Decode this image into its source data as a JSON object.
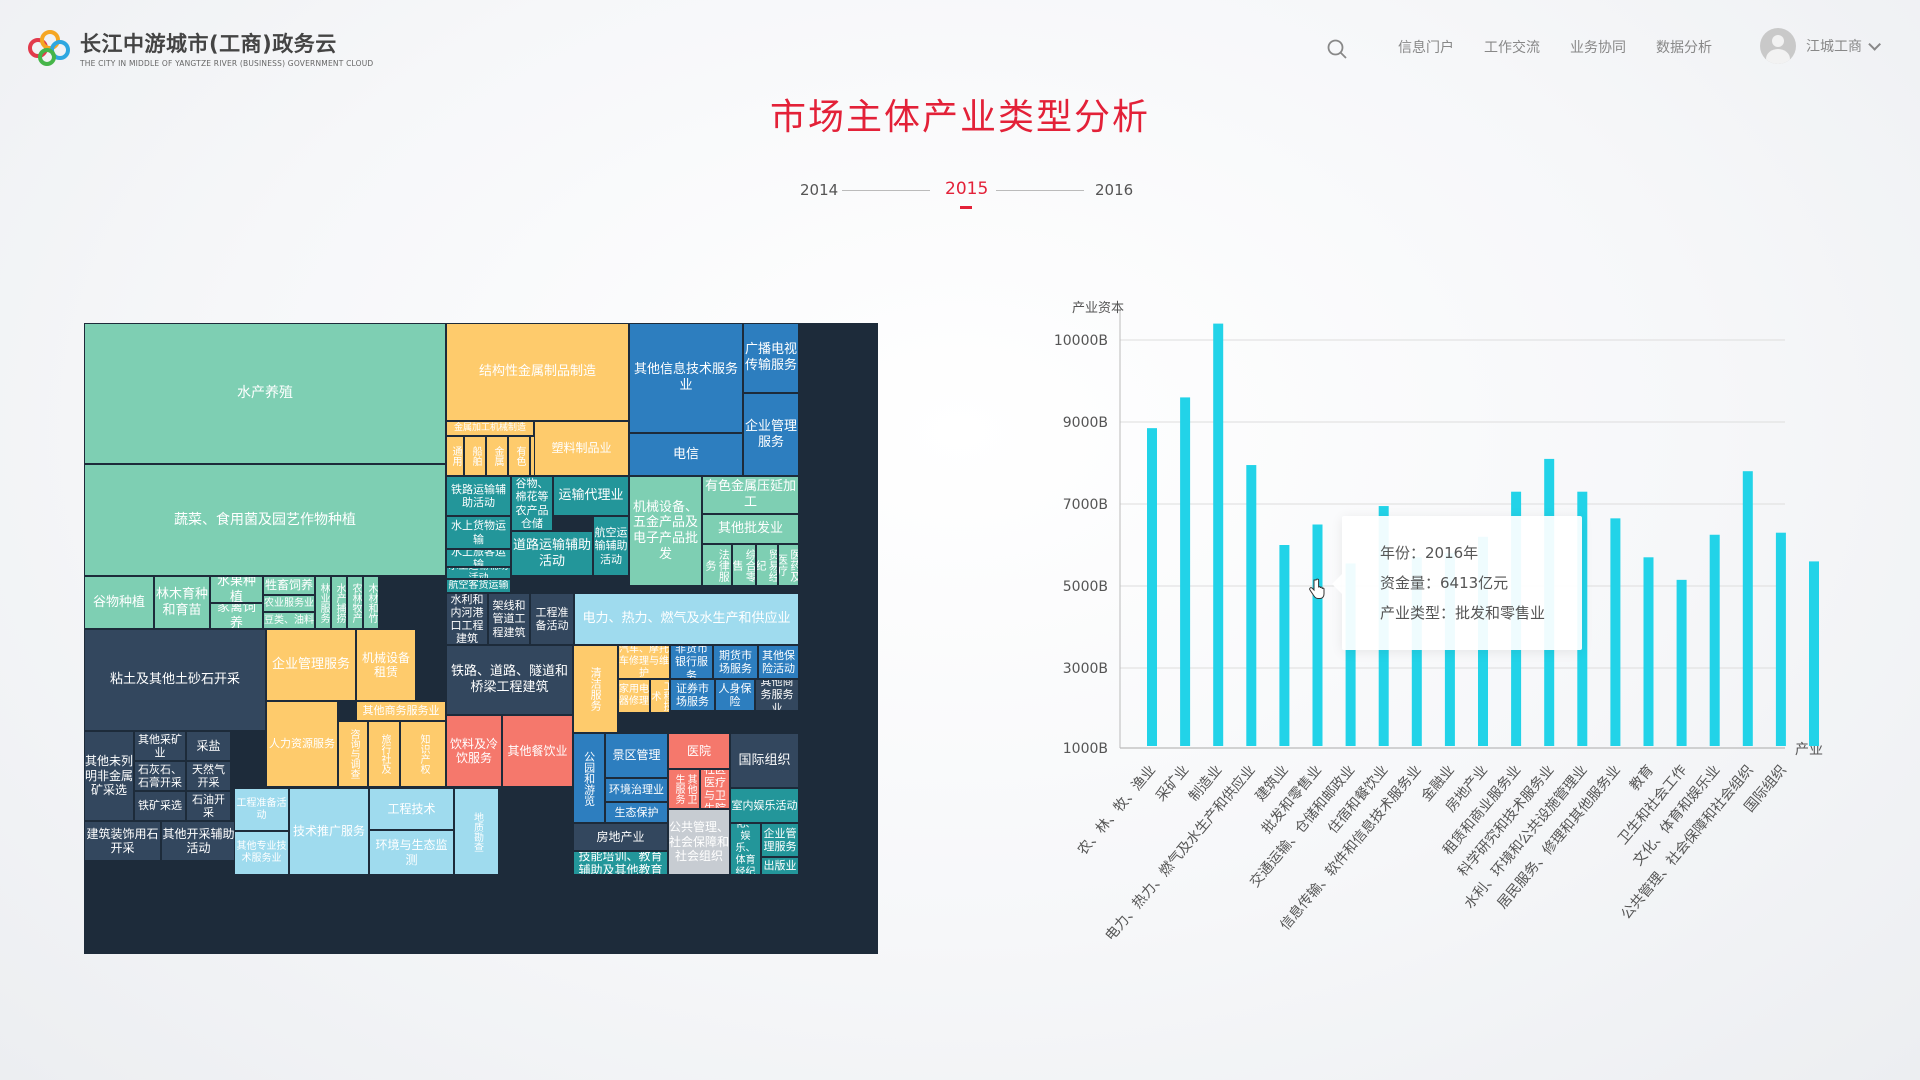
{
  "header": {
    "logo_title": "长江中游城市(工商)政务云",
    "logo_subtitle": "THE CITY IN MIDDLE OF YANGTZE RIVER (BUSINESS) GOVERNMENT CLOUD",
    "nav": [
      "信息门户",
      "工作交流",
      "业务协同",
      "数据分析"
    ],
    "user_name": "江城工商",
    "icons": [
      "search-icon",
      "avatar-icon",
      "chevron-down-icon"
    ]
  },
  "page_title": "市场主体产业类型分析",
  "timeline": {
    "years": [
      "2014",
      "2015",
      "2016"
    ],
    "active_year": "2015"
  },
  "tooltip": {
    "year": "年份：2016年",
    "capital": "资金量：6413亿元",
    "industry": "产业类型：批发和零售业"
  },
  "chart_data": [
    {
      "type": "treemap",
      "colors": {
        "teal_light": "#7ecfb3",
        "yellow": "#fecb6c",
        "blue": "#2d7ebf",
        "dark_teal": "#23969a",
        "navy": "#33475e",
        "sky": "#9fdbee",
        "salmon": "#f5786c",
        "grey": "#c7ccd2"
      },
      "cells": [
        {
          "label": "水产养殖",
          "color": "teal_light"
        },
        {
          "label": "蔬菜、食用菌及园艺作物种植",
          "color": "teal_light"
        },
        {
          "label": "谷物种植",
          "color": "teal_light"
        },
        {
          "label": "林木育种和育苗",
          "color": "teal_light"
        },
        {
          "label": "水果种植",
          "color": "teal_light"
        },
        {
          "label": "家禽饲养",
          "color": "teal_light"
        },
        {
          "label": "牲畜饲养",
          "color": "teal_light"
        },
        {
          "label": "农业服务业",
          "color": "teal_light"
        },
        {
          "label": "豆类、油料",
          "color": "teal_light"
        },
        {
          "label": "林业服务",
          "color": "teal_light"
        },
        {
          "label": "水产捕捞",
          "color": "teal_light"
        },
        {
          "label": "农林牧产",
          "color": "teal_light"
        },
        {
          "label": "木材和竹",
          "color": "teal_light"
        },
        {
          "label": "结构性金属制品制造",
          "color": "yellow"
        },
        {
          "label": "金属加工机械制造",
          "color": "yellow"
        },
        {
          "label": "通用",
          "color": "yellow"
        },
        {
          "label": "船舶",
          "color": "yellow"
        },
        {
          "label": "金属",
          "color": "yellow"
        },
        {
          "label": "有色",
          "color": "yellow"
        },
        {
          "label": "设备",
          "color": "yellow"
        },
        {
          "label": "塑料制品业",
          "color": "yellow"
        },
        {
          "label": "其他信息技术服务业",
          "color": "blue"
        },
        {
          "label": "广播电视传输服务",
          "color": "blue"
        },
        {
          "label": "电信",
          "color": "blue"
        },
        {
          "label": "企业管理服务",
          "color": "blue"
        },
        {
          "label": "铁路运输辅助活动",
          "color": "dark_teal"
        },
        {
          "label": "谷物、棉花等农产品仓储",
          "color": "dark_teal"
        },
        {
          "label": "运输代理业",
          "color": "dark_teal"
        },
        {
          "label": "水上货物运输",
          "color": "dark_teal"
        },
        {
          "label": "水上旅客运输",
          "color": "dark_teal"
        },
        {
          "label": "水上运输辅助活动",
          "color": "dark_teal"
        },
        {
          "label": "道路运输辅助活动",
          "color": "dark_teal"
        },
        {
          "label": "航空运输辅助活动",
          "color": "dark_teal"
        },
        {
          "label": "航空客货运输",
          "color": "dark_teal"
        },
        {
          "label": "机械设备、五金产品及电子产品批发",
          "color": "teal_light"
        },
        {
          "label": "有色金属压延加工",
          "color": "teal_light"
        },
        {
          "label": "其他批发业",
          "color": "teal_light"
        },
        {
          "label": "法律服务",
          "color": "teal_light"
        },
        {
          "label": "综合零售",
          "color": "teal_light"
        },
        {
          "label": "贸易经纪",
          "color": "teal_light"
        },
        {
          "label": "医药及医疗",
          "color": "teal_light"
        },
        {
          "label": "水利和内河港口工程建筑",
          "color": "navy"
        },
        {
          "label": "架线和管道工程建筑",
          "color": "navy"
        },
        {
          "label": "工程准备活动",
          "color": "navy"
        },
        {
          "label": "电力、热力、燃气及水生产和供应业",
          "color": "sky"
        },
        {
          "label": "粘土及其他土砂石开采",
          "color": "navy"
        },
        {
          "label": "其他未列明非金属矿采选",
          "color": "navy"
        },
        {
          "label": "其他采矿业",
          "color": "navy"
        },
        {
          "label": "采盐",
          "color": "navy"
        },
        {
          "label": "石灰石、石膏开采",
          "color": "navy"
        },
        {
          "label": "天然气开采",
          "color": "navy"
        },
        {
          "label": "铁矿采选",
          "color": "navy"
        },
        {
          "label": "石油开采",
          "color": "navy"
        },
        {
          "label": "建筑装饰用石开采",
          "color": "navy"
        },
        {
          "label": "其他开采辅助活动",
          "color": "navy"
        },
        {
          "label": "企业管理服务",
          "color": "yellow"
        },
        {
          "label": "机械设备租赁",
          "color": "yellow"
        },
        {
          "label": "其他商务服务业",
          "color": "yellow"
        },
        {
          "label": "人力资源服务",
          "color": "yellow"
        },
        {
          "label": "咨询与调查",
          "color": "yellow"
        },
        {
          "label": "旅行社及",
          "color": "yellow"
        },
        {
          "label": "知识产权",
          "color": "yellow"
        },
        {
          "label": "铁路、道路、隧道和桥梁工程建筑",
          "color": "navy"
        },
        {
          "label": "饮料及冷饮服务",
          "color": "salmon"
        },
        {
          "label": "其他餐饮业",
          "color": "salmon"
        },
        {
          "label": "清洁服务",
          "color": "yellow"
        },
        {
          "label": "汽车、摩托车修理与维护",
          "color": "yellow"
        },
        {
          "label": "家用电器修理",
          "color": "yellow"
        },
        {
          "label": "工程技术",
          "color": "yellow"
        },
        {
          "label": "非货币银行服务",
          "color": "blue"
        },
        {
          "label": "期货市场服务",
          "color": "blue"
        },
        {
          "label": "其他保险活动",
          "color": "blue"
        },
        {
          "label": "证券市场服务",
          "color": "blue"
        },
        {
          "label": "人身保险",
          "color": "blue"
        },
        {
          "label": "其他商务服务业",
          "color": "navy"
        },
        {
          "label": "公园和游览",
          "color": "blue"
        },
        {
          "label": "景区管理",
          "color": "blue"
        },
        {
          "label": "环境治理业",
          "color": "blue"
        },
        {
          "label": "生态保护",
          "color": "blue"
        },
        {
          "label": "医院",
          "color": "salmon"
        },
        {
          "label": "其他卫生服务",
          "color": "salmon"
        },
        {
          "label": "社区医疗与卫生院",
          "color": "salmon"
        },
        {
          "label": "国际组织",
          "color": "navy"
        },
        {
          "label": "室内娱乐活动",
          "color": "dark_teal"
        },
        {
          "label": "企业管理服务",
          "color": "dark_teal"
        },
        {
          "label": "出版业",
          "color": "dark_teal"
        },
        {
          "label": "文化、娱乐、体育经纪代理",
          "color": "dark_teal"
        },
        {
          "label": "房地产业",
          "color": "navy"
        },
        {
          "label": "技能培训、教育辅助及其他教育",
          "color": "dark_teal"
        },
        {
          "label": "公共管理、社会保障和社会组织",
          "color": "grey"
        },
        {
          "label": "其他信息技术服务业",
          "color": "sky"
        },
        {
          "label": "工程准备活动",
          "color": "sky"
        },
        {
          "label": "其他专业技术服务业",
          "color": "sky"
        },
        {
          "label": "技术推广服务",
          "color": "sky"
        },
        {
          "label": "工程技术",
          "color": "sky"
        },
        {
          "label": "环境与生态监测",
          "color": "sky"
        },
        {
          "label": "地质勘查",
          "color": "sky"
        }
      ]
    },
    {
      "type": "bar",
      "ylabel": "产业资本",
      "xlabel": "产业",
      "yticks": [
        "10000B",
        "9000B",
        "7000B",
        "5000B",
        "3000B",
        "1000B"
      ],
      "grid": true,
      "bar_color": "#22d3e8",
      "categories": [
        "农、林、牧、渔业",
        "采矿业",
        "制造业",
        "电力、热力、燃气及水生产和供应业",
        "建筑业",
        "批发和零售业",
        "交通运输、仓储和邮政业",
        "住宿和餐饮业",
        "信息传输、软件和信息技术服务业",
        "金融业",
        "房地产业",
        "租赁和商业服务业",
        "科学研究和技术服务业",
        "水利、环境和公共设施管理业",
        "居民服务、修理和其他服务业",
        "教育",
        "卫生和社会工作",
        "文化、体育和娱乐业",
        "公共管理、社会保障和社会组织",
        "国际组织"
      ],
      "values": [
        8850,
        9300,
        10200,
        7950,
        6000,
        6500,
        5550,
        6950,
        5700,
        5800,
        6200,
        7300,
        8100,
        7300,
        6650,
        5700,
        5150,
        6250,
        7800,
        6300,
        5600
      ]
    }
  ]
}
